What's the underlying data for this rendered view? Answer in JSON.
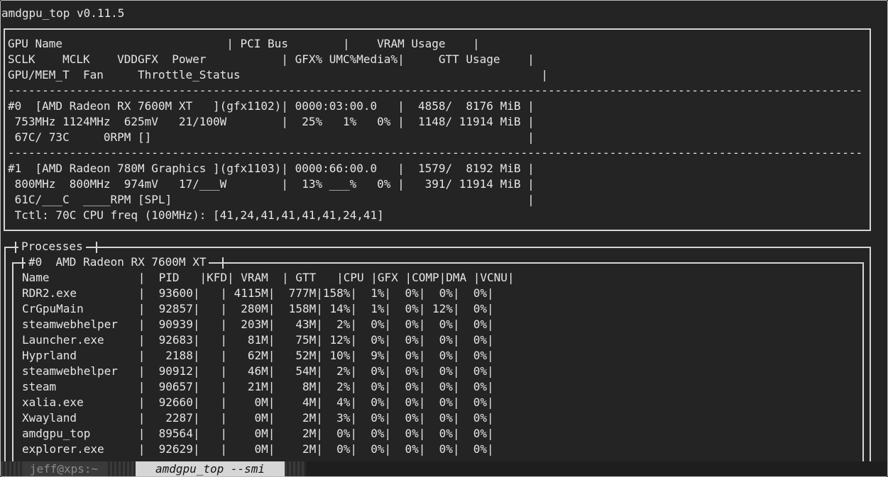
{
  "title": "amdgpu_top v0.11.5",
  "header": {
    "line1": "GPU Name                        | PCI Bus        |    VRAM Usage    |",
    "line2": "SCLK    MCLK    VDDGFX  Power           | GFX% UMC%Media%|     GTT Usage    |",
    "line3": "GPU/MEM_T  Fan     Throttle_Status                                            |",
    "separator": "-----------------------------------------------------------------------------------------------------------------------------"
  },
  "gpus": [
    {
      "line1": "#0  [AMD Radeon RX 7600M XT   ](gfx1102)| 0000:03:00.0   |  4858/  8176 MiB |",
      "line2": " 753MHz 1124MHz  625mV   21/100W        |  25%   1%   0% |  1148/ 11914 MiB |",
      "line3": " 67C/ 73C     0RPM []                                                       |"
    },
    {
      "line1": "#1  [AMD Radeon 780M Graphics ](gfx1103)| 0000:66:00.0   |  1579/  8192 MiB |",
      "line2": " 800MHz  800MHz  974mV   17/___W        |  13% ___%   0% |   391/ 11914 MiB |",
      "line3": " 61C/___C  ____RPM [SPL]                                                    |",
      "line4": " Tctl: 70C CPU freq (100MHz): [41,24,41,41,41,41,24,41]"
    }
  ],
  "processes": {
    "title": "Processes",
    "gpu_label": "#0  AMD Radeon RX 7600M XT",
    "header": "Name             |  PID   |KFD| VRAM  | GTT   |CPU |GFX |COMP|DMA |VCNU|",
    "rows": [
      "RDR2.exe         |  93600|   | 4115M|  777M|158%|  1%|  0%|  0%|  0%|",
      "CrGpuMain        |  92857|   |  280M|  158M| 14%|  1%|  0%| 12%|  0%|",
      "steamwebhelper   |  90939|   |  203M|   43M|  2%|  0%|  0%|  0%|  0%|",
      "Launcher.exe     |  92683|   |   81M|   75M| 12%|  0%|  0%|  0%|  0%|",
      "Hyprland         |   2188|   |   62M|   52M| 10%|  9%|  0%|  0%|  0%|",
      "steamwebhelper   |  90912|   |   46M|   54M|  2%|  0%|  0%|  0%|  0%|",
      "steam            |  90657|   |   21M|    8M|  2%|  0%|  0%|  0%|  0%|",
      "xalia.exe        |  92660|   |    0M|    4M|  4%|  0%|  0%|  0%|  0%|",
      "Xwayland         |   2287|   |    0M|    2M|  3%|  0%|  0%|  0%|  0%|",
      "amdgpu_top       |  89564|   |    0M|    2M|  0%|  0%|  0%|  0%|  0%|",
      "explorer.exe     |  92629|   |    0M|    2M|  0%|  0%|  0%|  0%|  0%|"
    ]
  },
  "tabs": [
    {
      "label": "jeff@xps:~",
      "active": false
    },
    {
      "label": "amdgpu_top --smi",
      "active": true
    }
  ],
  "colors": {
    "background": "#242424",
    "text": "#e6e6e6",
    "border": "#d6d6d6",
    "tab_inactive_bg": "#3a3a3a",
    "tab_inactive_text": "#8a8a8a",
    "tab_active_bg": "#d6d6d6",
    "tab_active_text": "#111111"
  }
}
